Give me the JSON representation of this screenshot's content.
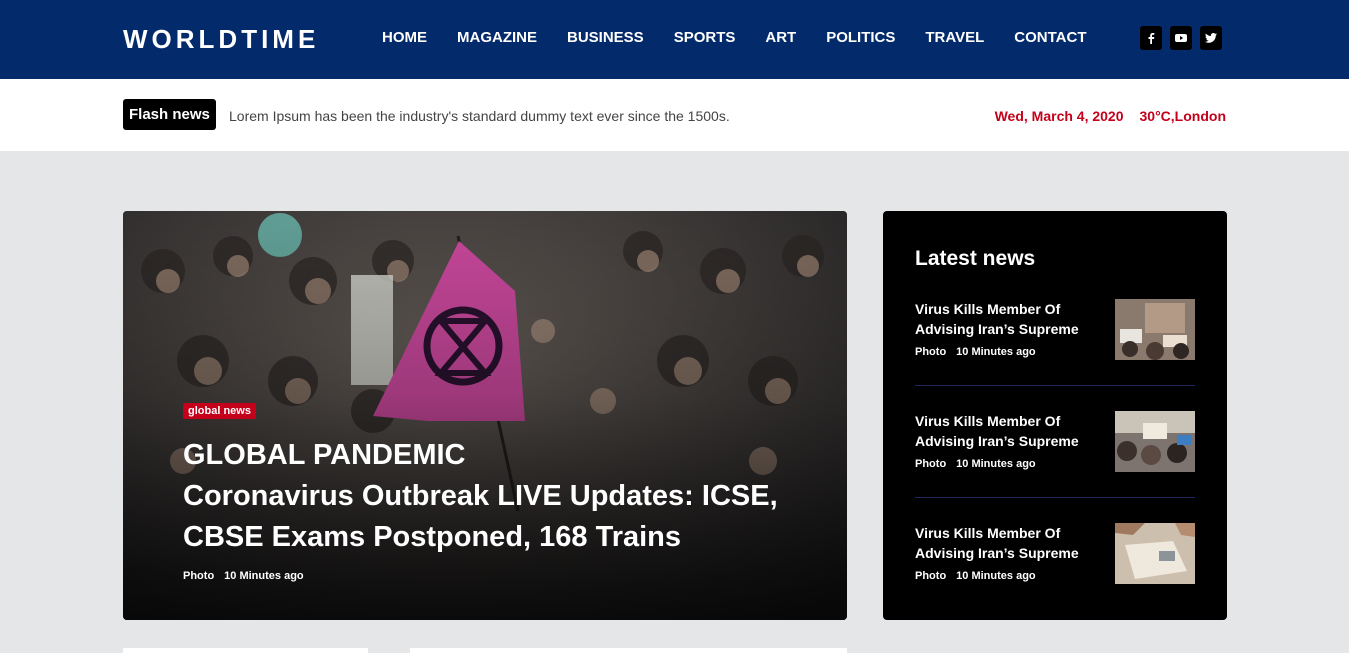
{
  "header": {
    "logo": "WORLDTIME",
    "nav": [
      "HOME",
      "MAGAZINE",
      "BUSINESS",
      "SPORTS",
      "ART",
      "POLITICS",
      "TRAVEL",
      "CONTACT"
    ],
    "social": [
      {
        "icon": "facebook-icon",
        "glyph": "f"
      },
      {
        "icon": "youtube-icon",
        "glyph": "▶"
      },
      {
        "icon": "twitter-icon",
        "glyph": "t"
      }
    ],
    "bg_color": "#032a6b"
  },
  "flash": {
    "badge": "Flash news",
    "text": "Lorem Ipsum has been the industry's standard dummy text ever since the 1500s.",
    "date": "Wed, March 4, 2020",
    "weather": "30°C,London",
    "accent_color": "#c4001a"
  },
  "hero": {
    "tag": "global news",
    "title_line1": "GLOBAL PANDEMIC",
    "title_line2": "Coronavirus Outbreak LIVE Updates: ICSE,",
    "title_line3": "CBSE Exams Postponed, 168 Trains",
    "meta_type": "Photo",
    "meta_time": "10 Minutes ago"
  },
  "latest": {
    "heading": "Latest news",
    "items": [
      {
        "title": "Virus Kills Member Of Advising Iran’s Supreme",
        "type": "Photo",
        "time": "10 Minutes ago"
      },
      {
        "title": "Virus Kills Member Of Advising Iran’s Supreme",
        "type": "Photo",
        "time": "10 Minutes ago"
      },
      {
        "title": "Virus Kills Member Of Advising Iran’s Supreme",
        "type": "Photo",
        "time": "10 Minutes ago"
      }
    ]
  }
}
